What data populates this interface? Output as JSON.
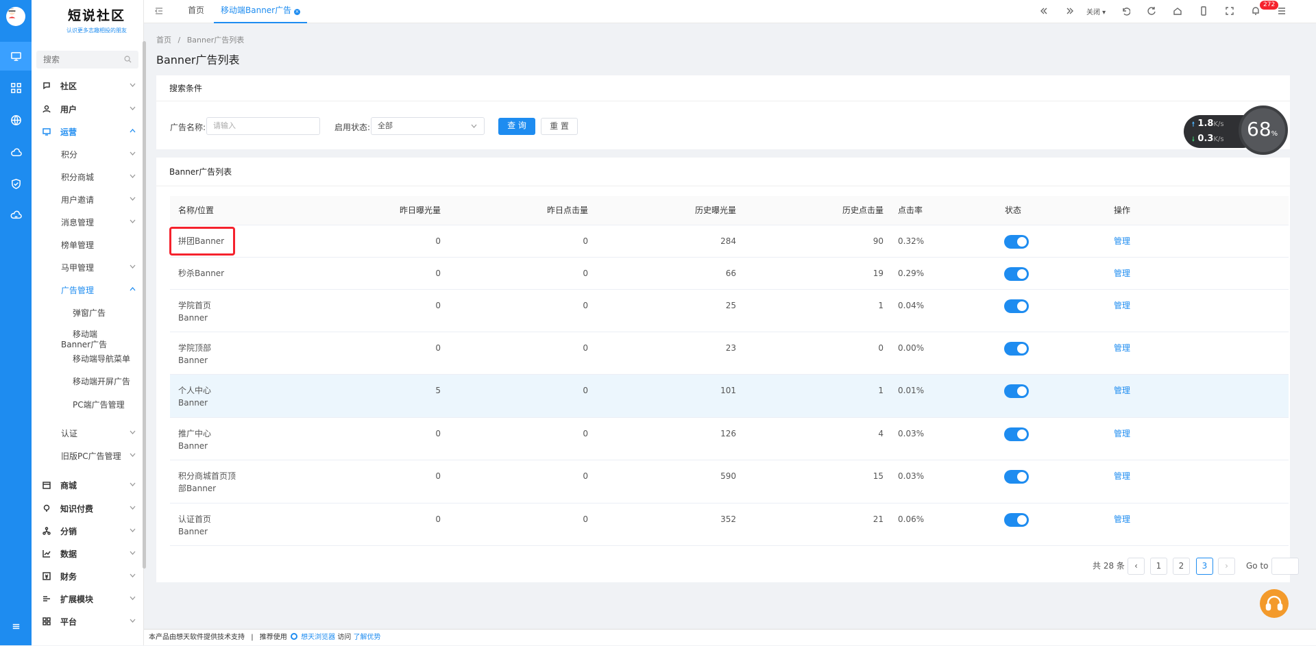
{
  "brand": {
    "title": "短说社区",
    "slogan": "认识更多志趣相投的朋友"
  },
  "search": {
    "placeholder": "搜索"
  },
  "sidebar": {
    "groups": [
      {
        "label": "社区"
      },
      {
        "label": "用户"
      },
      {
        "label": "运营"
      }
    ],
    "operations_children": [
      "积分",
      "积分商城",
      "用户邀请",
      "消息管理",
      "榜单管理",
      "马甲管理",
      "广告管理"
    ],
    "ad_children": [
      "弹窗广告",
      "移动端Banner广告",
      "移动端导航菜单",
      "移动端开屏广告",
      "PC端广告管理"
    ],
    "more_children": [
      "认证",
      "旧版PC广告管理"
    ],
    "bottom_groups": [
      "商城",
      "知识付费",
      "分销",
      "数据",
      "财务",
      "扩展模块",
      "平台"
    ]
  },
  "topbar": {
    "tabs": [
      {
        "label": "首页"
      },
      {
        "label": "移动端Banner广告"
      }
    ],
    "close_label": "关闭",
    "notification_count": "272"
  },
  "breadcrumb": {
    "home": "首页",
    "sep": "/",
    "current": "Banner广告列表"
  },
  "page_title": "Banner广告列表",
  "filter": {
    "title": "搜索条件",
    "name_label": "广告名称:",
    "name_placeholder": "请输入",
    "status_label": "启用状态:",
    "status_value": "全部",
    "query_button": "查 询",
    "reset_button": "重 置"
  },
  "table": {
    "title": "Banner广告列表",
    "headers": [
      "名称/位置",
      "昨日曝光量",
      "昨日点击量",
      "历史曝光量",
      "历史点击量",
      "点击率",
      "状态",
      "操作"
    ],
    "rows": [
      {
        "name1": "拼团Banner",
        "name2": "",
        "y_exp": "0",
        "y_clk": "0",
        "h_exp": "284",
        "h_clk": "90",
        "rate": "0.32%",
        "enabled": true,
        "action": "管理"
      },
      {
        "name1": "秒杀Banner",
        "name2": "",
        "y_exp": "0",
        "y_clk": "0",
        "h_exp": "66",
        "h_clk": "19",
        "rate": "0.29%",
        "enabled": true,
        "action": "管理"
      },
      {
        "name1": "学院首页",
        "name2": "Banner",
        "y_exp": "0",
        "y_clk": "0",
        "h_exp": "25",
        "h_clk": "1",
        "rate": "0.04%",
        "enabled": true,
        "action": "管理"
      },
      {
        "name1": "学院顶部",
        "name2": "Banner",
        "y_exp": "0",
        "y_clk": "0",
        "h_exp": "23",
        "h_clk": "0",
        "rate": "0.00%",
        "enabled": true,
        "action": "管理"
      },
      {
        "name1": "个人中心",
        "name2": "Banner",
        "y_exp": "5",
        "y_clk": "0",
        "h_exp": "101",
        "h_clk": "1",
        "rate": "0.01%",
        "enabled": true,
        "action": "管理"
      },
      {
        "name1": "推广中心",
        "name2": "Banner",
        "y_exp": "0",
        "y_clk": "0",
        "h_exp": "126",
        "h_clk": "4",
        "rate": "0.03%",
        "enabled": true,
        "action": "管理"
      },
      {
        "name1": "积分商城首页顶",
        "name2": "部Banner",
        "y_exp": "0",
        "y_clk": "0",
        "h_exp": "590",
        "h_clk": "15",
        "rate": "0.03%",
        "enabled": true,
        "action": "管理"
      },
      {
        "name1": "认证首页",
        "name2": "Banner",
        "y_exp": "0",
        "y_clk": "0",
        "h_exp": "352",
        "h_clk": "21",
        "rate": "0.06%",
        "enabled": true,
        "action": "管理"
      }
    ]
  },
  "pagination": {
    "total": "共 28 条",
    "pages": [
      "1",
      "2",
      "3"
    ],
    "current": "3",
    "goto_label": "Go to"
  },
  "speed_widget": {
    "up": "1.8",
    "down": "0.3",
    "unit": "K/s",
    "percent": "68",
    "pct_sign": "%"
  },
  "footer": {
    "text1": "本产品由想天软件提供技术支持",
    "sep": "|",
    "text2": "推荐使用",
    "browser": "想天浏览器",
    "text3": "访问",
    "link": "了解优势"
  },
  "colors": {
    "primary": "#1e8cf0",
    "highlight": "#f5222d"
  }
}
